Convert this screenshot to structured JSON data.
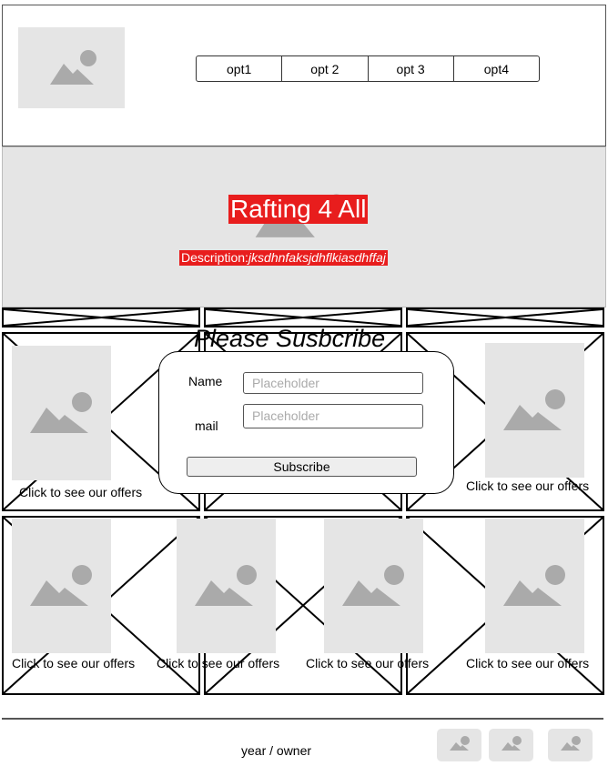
{
  "header": {
    "logo_icon": "image-placeholder-icon",
    "nav": [
      "opt1",
      "opt 2",
      "opt 3",
      "opt4"
    ]
  },
  "hero": {
    "title": "Rafting 4 All",
    "description_label": "Description:",
    "description_text": "jksdhnfaksjdhflkiasdhffaj",
    "accent_color": "#e81d1d"
  },
  "subscribe": {
    "title": "Please Susbcribe",
    "name_label": "Name",
    "name_placeholder": "Placeholder",
    "mail_label": "mail",
    "mail_placeholder": "Placeholder",
    "button_label": "Subscribe"
  },
  "offers": {
    "caption": "Click to see our offers"
  },
  "footer": {
    "text": "year / owner",
    "icons": [
      "image-icon",
      "image-icon",
      "image-icon"
    ]
  }
}
